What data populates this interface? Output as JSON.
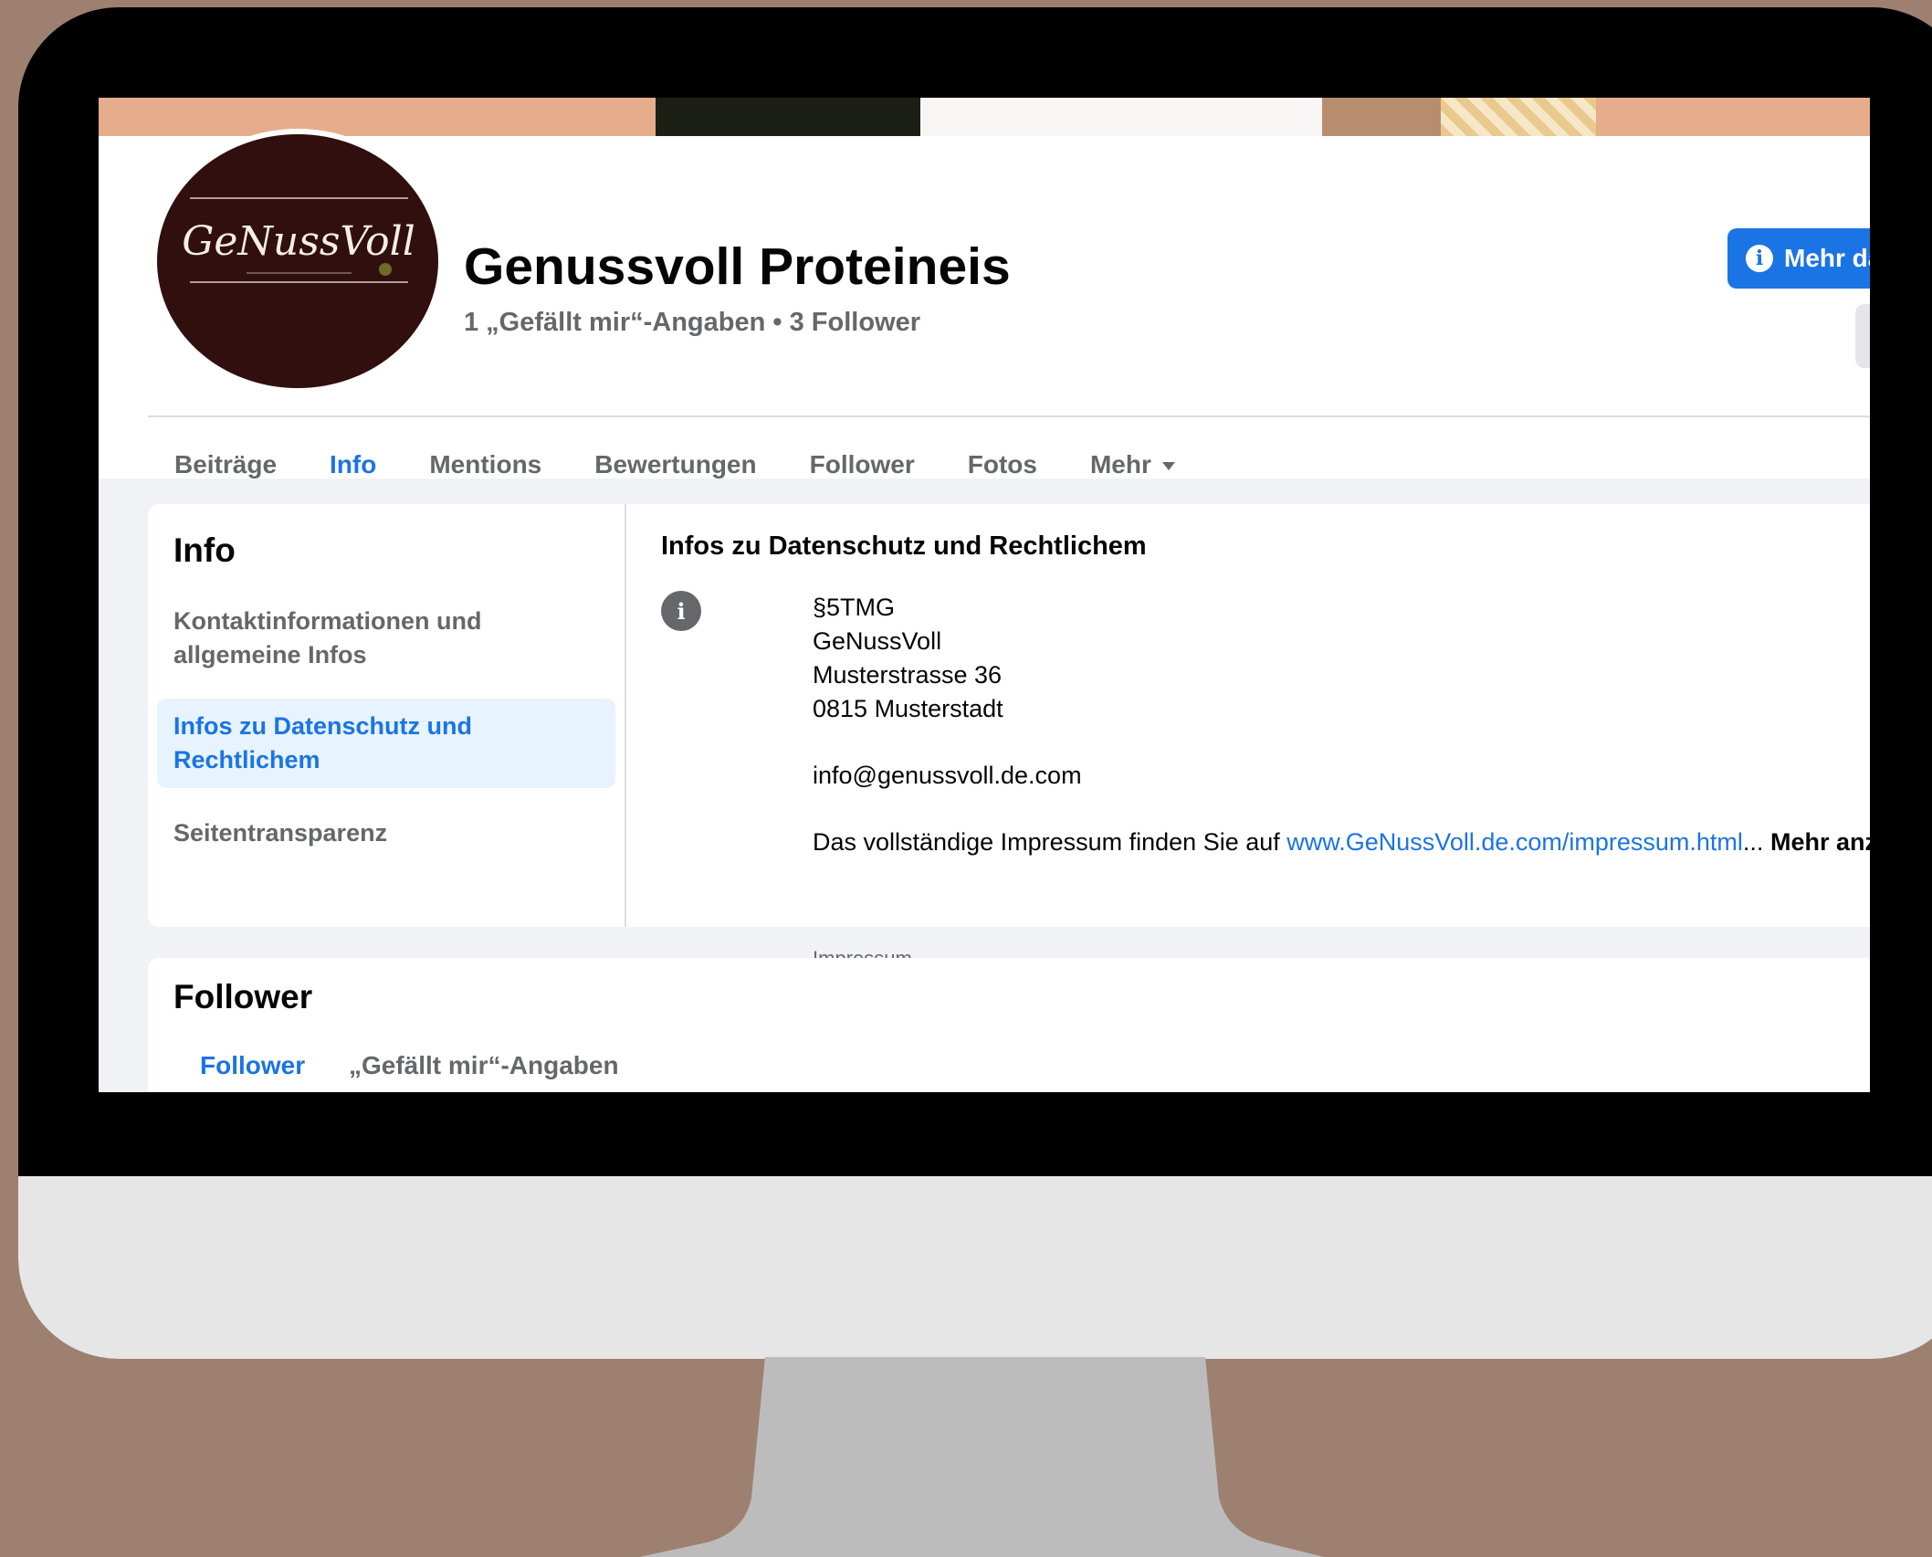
{
  "page": {
    "name": "Genussvoll Proteineis",
    "stats": "1 „Gefällt mir“-Angaben • 3 Follower",
    "logo_text": "GeNussVoll",
    "primary_button": "Mehr dazu"
  },
  "tabs": [
    {
      "label": "Beiträge"
    },
    {
      "label": "Info",
      "active": true
    },
    {
      "label": "Mentions"
    },
    {
      "label": "Bewertungen"
    },
    {
      "label": "Follower"
    },
    {
      "label": "Fotos"
    },
    {
      "label": "Mehr"
    }
  ],
  "info": {
    "title": "Info",
    "sidebar": [
      {
        "label": "Kontaktinformationen und allgemeine Infos"
      },
      {
        "label": "Infos zu Datenschutz und Rechtlichem",
        "active": true
      },
      {
        "label": "Seitentransparenz"
      }
    ],
    "legal": {
      "title": "Infos zu Datenschutz und Rechtlichem",
      "lines": [
        "§5TMG",
        "GeNussVoll",
        "Musterstrasse 36",
        "0815 Musterstadt"
      ],
      "email": "info@genussvoll.de.com",
      "impressum_prefix": "Das vollständige Impressum finden Sie auf ",
      "impressum_link": "www.GeNussVoll.de.com/impressum.html",
      "ellipsis": "...",
      "more": "Mehr anzeigen",
      "sub_label": "Impressum"
    }
  },
  "follower": {
    "title": "Follower",
    "tabs": [
      {
        "label": "Follower",
        "active": true
      },
      {
        "label": "„Gefällt mir“-Angaben"
      }
    ]
  },
  "colors": {
    "accent": "#1b74e4",
    "background": "#9e8070",
    "avatar": "#310f0e"
  }
}
